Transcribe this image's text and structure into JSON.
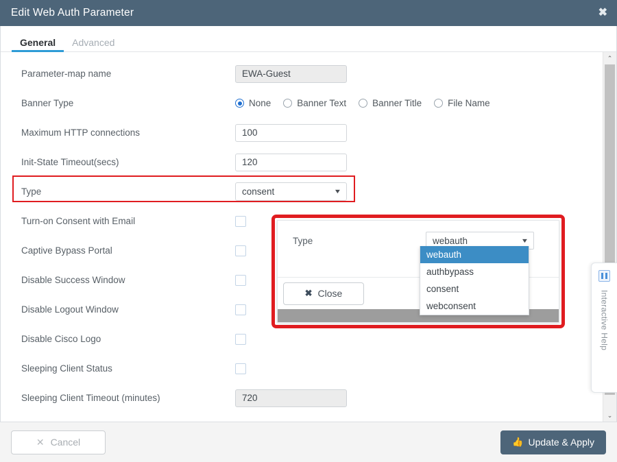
{
  "window": {
    "title": "Edit Web Auth Parameter",
    "close_icon": "close-icon",
    "close_glyph": "✖"
  },
  "tabs": [
    {
      "label": "General",
      "active": true
    },
    {
      "label": "Advanced",
      "active": false
    }
  ],
  "form": {
    "parameter_map_name": {
      "label": "Parameter-map name",
      "value": "EWA-Guest",
      "readonly": true
    },
    "banner_type": {
      "label": "Banner Type",
      "selected": "None",
      "options": [
        "None",
        "Banner Text",
        "Banner Title",
        "File Name"
      ]
    },
    "max_http_connections": {
      "label": "Maximum HTTP connections",
      "value": "100"
    },
    "init_state_timeout": {
      "label": "Init-State Timeout(secs)",
      "value": "120"
    },
    "type": {
      "label": "Type",
      "value": "consent",
      "caret_icon": "chevron-down-icon"
    },
    "checkboxes": [
      {
        "label": "Turn-on Consent with Email",
        "checked": false
      },
      {
        "label": "Captive Bypass Portal",
        "checked": false
      },
      {
        "label": "Disable Success Window",
        "checked": false
      },
      {
        "label": "Disable Logout Window",
        "checked": false
      },
      {
        "label": "Disable Cisco Logo",
        "checked": false
      },
      {
        "label": "Sleeping Client Status",
        "checked": false
      }
    ],
    "sleeping_client_timeout": {
      "label": "Sleeping Client Timeout (minutes)",
      "value": "720",
      "readonly": true
    }
  },
  "popup": {
    "type_label": "Type",
    "type_value": "webauth",
    "caret_icon": "chevron-down-icon",
    "close_button": "Close",
    "close_icon_glyph": "✖",
    "dropdown_options": [
      {
        "label": "webauth",
        "selected": true
      },
      {
        "label": "authbypass",
        "selected": false
      },
      {
        "label": "consent",
        "selected": false
      },
      {
        "label": "webconsent",
        "selected": false
      }
    ]
  },
  "help_tab": {
    "label": "Interactive Help",
    "icon": "help-panel-icon"
  },
  "scrollbar": {
    "up_glyph": "⌃",
    "down_glyph": "⌄"
  },
  "footer": {
    "cancel_label": "Cancel",
    "cancel_icon_glyph": "✕",
    "apply_label": "Update & Apply",
    "apply_icon_glyph": "👍"
  },
  "colors": {
    "titlebar": "#4d6579",
    "accent_blue": "#2e9bd6",
    "highlight_red": "#e01c20",
    "dropdown_selected": "#3c8dc5",
    "primary_button": "#4d6579"
  }
}
